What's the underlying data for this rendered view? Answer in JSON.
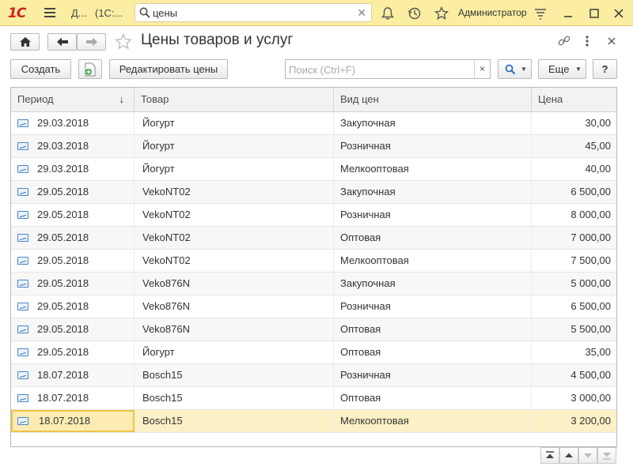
{
  "titlebar": {
    "logo": "1С",
    "doc_short": "Д...",
    "doc_title": "(1С:...",
    "search_value": "цены",
    "user": "Администратор"
  },
  "header": {
    "title": "Цены товаров и услуг"
  },
  "toolbar": {
    "create_label": "Создать",
    "edit_prices_label": "Редактировать цены",
    "search_placeholder": "Поиск (Ctrl+F)",
    "clear_label": "×",
    "more_label": "Еще",
    "help_label": "?"
  },
  "table": {
    "columns": [
      "Период",
      "Товар",
      "Вид цен",
      "Цена"
    ],
    "rows": [
      [
        "29.03.2018",
        "Йогурт",
        "Закупочная",
        "30,00"
      ],
      [
        "29.03.2018",
        "Йогурт",
        "Розничная",
        "45,00"
      ],
      [
        "29.03.2018",
        "Йогурт",
        "Мелкооптовая",
        "40,00"
      ],
      [
        "29.05.2018",
        "VekoNT02",
        "Закупочная",
        "6 500,00"
      ],
      [
        "29.05.2018",
        "VekoNT02",
        "Розничная",
        "8 000,00"
      ],
      [
        "29.05.2018",
        "VekoNT02",
        "Оптовая",
        "7 000,00"
      ],
      [
        "29.05.2018",
        "VekoNT02",
        "Мелкооптовая",
        "7 500,00"
      ],
      [
        "29.05.2018",
        "Veko876N",
        "Закупочная",
        "5 000,00"
      ],
      [
        "29.05.2018",
        "Veko876N",
        "Розничная",
        "6 500,00"
      ],
      [
        "29.05.2018",
        "Veko876N",
        "Оптовая",
        "5 500,00"
      ],
      [
        "29.05.2018",
        "Йогурт",
        "Оптовая",
        "35,00"
      ],
      [
        "18.07.2018",
        "Bosch15",
        "Розничная",
        "4 500,00"
      ],
      [
        "18.07.2018",
        "Bosch15",
        "Оптовая",
        "3 000,00"
      ],
      [
        "18.07.2018",
        "Bosch15",
        "Мелкооптовая",
        "3 200,00"
      ]
    ],
    "selected_row": 13
  },
  "colors": {
    "titlebar_bg": "#fbeda2",
    "selected_row_bg": "#fcf1c6",
    "selected_cell_border": "#f0c34a"
  }
}
